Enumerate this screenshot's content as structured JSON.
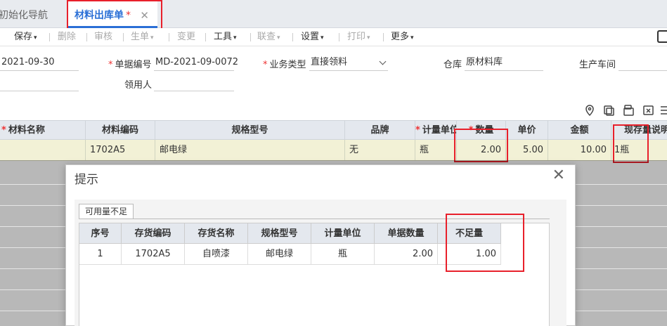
{
  "tabs": {
    "nav_label": "初始化导航",
    "active_label": "材料出库单",
    "active_star": "*",
    "close_glyph": "✕"
  },
  "toolbar": {
    "save": "保存",
    "delete": "删除",
    "audit": "审核",
    "generate": "生单",
    "change": "变更",
    "tools": "工具",
    "query": "联查",
    "settings": "设置",
    "print": "打印",
    "more": "更多",
    "caret": "▾"
  },
  "form": {
    "date_value": "2021-09-30",
    "doc_no_label": "单据编号",
    "doc_no_value": "MD-2021-09-0072",
    "biz_type_label": "业务类型",
    "biz_type_value": "直接领料",
    "warehouse_label": "仓库",
    "warehouse_value": "原材料库",
    "workshop_label": "生产车间",
    "receiver_label": "领用人",
    "required_mark": "*"
  },
  "grid": {
    "headers": {
      "material_name": "材料名称",
      "material_code": "材料编码",
      "spec": "规格型号",
      "brand": "品牌",
      "unit": "计量单位",
      "qty": "数量",
      "price": "单价",
      "amount": "金额",
      "stock_desc": "现存量说明"
    },
    "row": {
      "material_name": "",
      "material_code": "1702A5",
      "spec": "邮电绿",
      "brand": "无",
      "unit": "瓶",
      "qty": "2.00",
      "price": "5.00",
      "amount": "10.00",
      "stock_desc": "1瓶"
    }
  },
  "dialog": {
    "title": "提示",
    "close_glyph": "✕",
    "subtab": "可用量不足",
    "headers": {
      "seq": "序号",
      "inv_code": "存货编码",
      "inv_name": "存货名称",
      "spec": "规格型号",
      "unit": "计量单位",
      "doc_qty": "单据数量",
      "shortage": "不足量"
    },
    "row": {
      "seq": "1",
      "inv_code": "1702A5",
      "inv_name": "自喷漆",
      "spec": "邮电绿",
      "unit": "瓶",
      "doc_qty": "2.00",
      "shortage": "1.00"
    }
  },
  "colors": {
    "accent": "#2a6fd6",
    "highlight_box": "#e8202b",
    "selected_row": "#f2f1d6",
    "header_bg": "#e4e8ee"
  }
}
